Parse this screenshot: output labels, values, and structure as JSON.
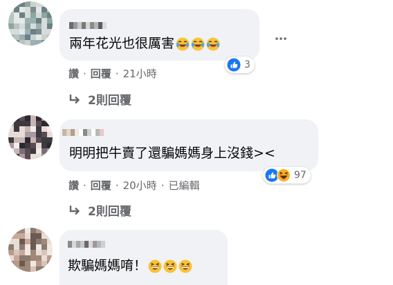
{
  "comments": [
    {
      "text": "兩年花光也很厲害",
      "emoji": [
        "laughing-crying-emoji",
        "laughing-crying-emoji",
        "laughing-crying-emoji"
      ],
      "reaction_count": "3",
      "actions": {
        "like": "讚",
        "reply": "回覆",
        "time": "21小時"
      },
      "replies_label": "2則回覆"
    },
    {
      "text": "明明把牛賣了還騙媽媽身上沒錢><",
      "reaction_count": "97",
      "actions": {
        "like": "讚",
        "reply": "回覆",
        "time": "20小時",
        "edited": "已編輯"
      },
      "replies_label": "2則回覆"
    },
    {
      "text": "欺騙媽媽唷！",
      "emoji": [
        "grinning-squint-emoji",
        "grinning-squint-emoji",
        "grinning-squint-emoji"
      ]
    }
  ],
  "colors": {
    "bubble": "#f0f2f5",
    "secondary_text": "#65676b",
    "like_blue": "#1877f2",
    "haha_yellow": "#f7b125"
  }
}
